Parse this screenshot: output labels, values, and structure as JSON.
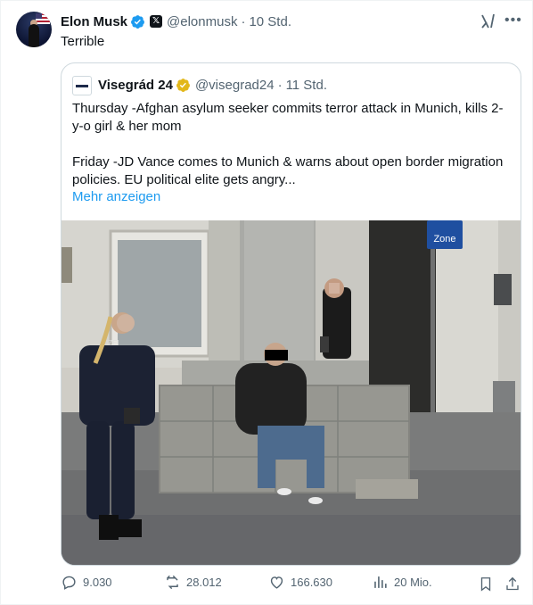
{
  "author": {
    "name": "Elon Musk",
    "badge_icon": "x-logo-badge",
    "handle": "@elonmusk",
    "separator": "·",
    "time": "10 Std."
  },
  "tweet_text": "Terrible",
  "quoted": {
    "name": "Visegrád 24",
    "handle": "@visegrad24",
    "separator": "·",
    "time": "11 Std.",
    "paragraph1": "Thursday -Afghan asylum seeker commits terror attack in Munich, kills 2-y-o girl & her mom",
    "paragraph2": "Friday -JD Vance comes to Munich & warns about open border migration policies. EU political elite gets angry...",
    "more_link": "Mehr anzeigen",
    "photo_sign": "Zone"
  },
  "actions": {
    "replies": "9.030",
    "reposts": "28.012",
    "likes": "166.630",
    "views": "20 Mio."
  },
  "colors": {
    "verified_blue": "#1d9bf0",
    "gold_badge": "#e2b719",
    "secondary_text": "#536471",
    "link": "#1d9bf0"
  }
}
